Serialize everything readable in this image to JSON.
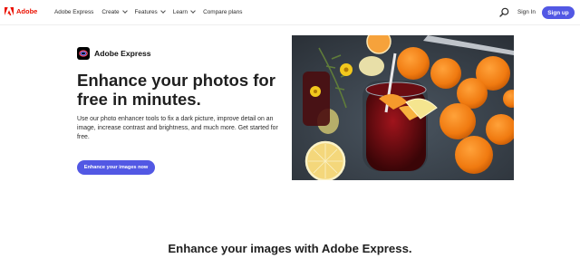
{
  "header": {
    "logo_text": "Adobe",
    "nav": [
      {
        "label": "Adobe Express",
        "has_dropdown": false
      },
      {
        "label": "Create",
        "has_dropdown": true
      },
      {
        "label": "Features",
        "has_dropdown": true
      },
      {
        "label": "Learn",
        "has_dropdown": true
      },
      {
        "label": "Compare plans",
        "has_dropdown": false
      }
    ],
    "search_icon": "search-icon",
    "sign_in": "Sign In",
    "sign_up": "Sign up"
  },
  "hero": {
    "brand_name": "Adobe Express",
    "headline": "Enhance your photos for free in minutes.",
    "description": "Use our photo enhancer tools to fix a dark picture, improve detail on an image, increase contrast and brightness, and much more. Get started for free.",
    "cta": "Enhance your images now",
    "image": "photo-of-drink-with-oranges"
  },
  "section": {
    "title": "Enhance your images with Adobe Express."
  },
  "colors": {
    "brand_red": "#eb1000",
    "accent": "#5258e4",
    "text": "#2c2c2c"
  }
}
